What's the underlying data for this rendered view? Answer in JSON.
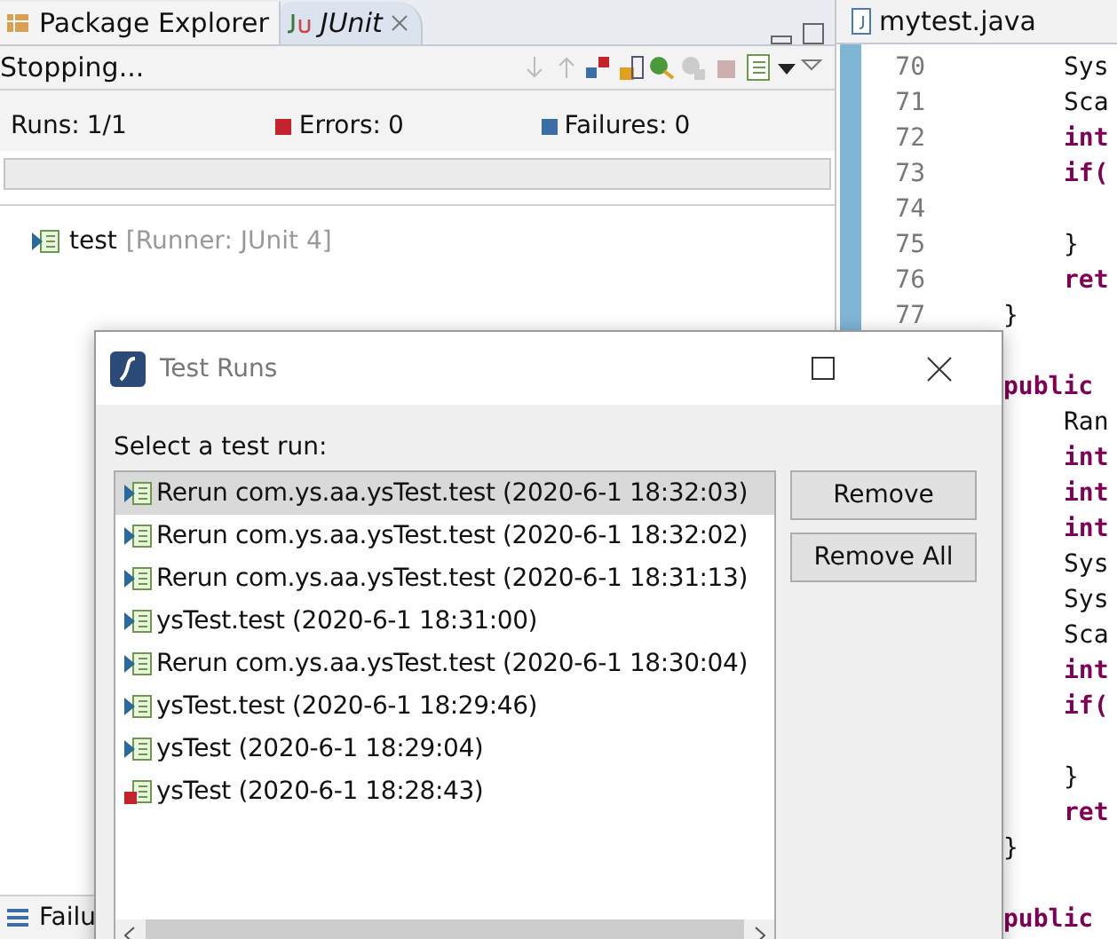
{
  "left_tabs": [
    {
      "label": "Package Explorer",
      "selected": false,
      "closable": false
    },
    {
      "label": "JUnit",
      "selected": true,
      "closable": true
    }
  ],
  "junit": {
    "status": "Stopping...",
    "counters": [
      {
        "kind": "runs",
        "label": "Runs:",
        "value": "1/1"
      },
      {
        "kind": "errors",
        "label": "Errors:",
        "value": "0"
      },
      {
        "kind": "failures",
        "label": "Failures:",
        "value": "0"
      }
    ],
    "progress": {
      "level": 0
    },
    "tree": [
      {
        "name": "test",
        "detail": "[Runner: JUnit 4]"
      }
    ]
  },
  "bottom_tab": {
    "label": "Failu"
  },
  "editor": {
    "tab": "mytest.java",
    "lines": [
      {
        "number": "70",
        "code": "Sys",
        "keyword": false,
        "kind": "inner"
      },
      {
        "number": "71",
        "code": "Sca",
        "keyword": false,
        "kind": "inner"
      },
      {
        "number": "72",
        "code": "int",
        "keyword": true,
        "kind": "inner"
      },
      {
        "number": "73",
        "code": "if(",
        "keyword": true,
        "kind": "inner"
      },
      {
        "number": "74",
        "kind": "inner"
      },
      {
        "number": "75",
        "code": "}",
        "keyword": false,
        "kind": "inner"
      },
      {
        "number": "76",
        "code": "ret",
        "keyword": true,
        "kind": "inner"
      },
      {
        "number": "77",
        "code": "}",
        "keyword": false,
        "kind": "outer"
      },
      {
        "kind": "outer"
      },
      {
        "code": "public",
        "keyword": true,
        "kind": "outer"
      },
      {
        "code": "Ran",
        "keyword": false,
        "kind": "inner"
      },
      {
        "code": "int",
        "keyword": true,
        "kind": "inner"
      },
      {
        "code": "int",
        "keyword": true,
        "kind": "inner"
      },
      {
        "code": "int",
        "keyword": true,
        "kind": "inner"
      },
      {
        "code": "Sys",
        "keyword": false,
        "kind": "inner"
      },
      {
        "code": "Sys",
        "keyword": false,
        "kind": "inner"
      },
      {
        "code": "Sca",
        "keyword": false,
        "kind": "inner"
      },
      {
        "code": "int",
        "keyword": true,
        "kind": "inner"
      },
      {
        "code": "if(",
        "keyword": true,
        "kind": "inner"
      },
      {
        "kind": "inner"
      },
      {
        "code": "}",
        "keyword": false,
        "kind": "inner"
      },
      {
        "code": "ret",
        "keyword": true,
        "kind": "inner"
      },
      {
        "code": "}",
        "keyword": false,
        "kind": "outer"
      },
      {
        "kind": "outer"
      },
      {
        "code": "public",
        "keyword": true,
        "kind": "outer"
      }
    ]
  },
  "dialog": {
    "title": "Test Runs",
    "prompt": "Select a test run:",
    "runs": [
      {
        "label": "Rerun com.ys.aa.ysTest.test (2020-6-1 18:32:03)",
        "kind": "passed",
        "selected": true
      },
      {
        "label": "Rerun com.ys.aa.ysTest.test (2020-6-1 18:32:02)",
        "kind": "passed",
        "selected": false
      },
      {
        "label": "Rerun com.ys.aa.ysTest.test (2020-6-1 18:31:13)",
        "kind": "passed",
        "selected": false
      },
      {
        "label": "ysTest.test (2020-6-1 18:31:00)",
        "kind": "passed",
        "selected": false
      },
      {
        "label": "Rerun com.ys.aa.ysTest.test (2020-6-1 18:30:04)",
        "kind": "passed",
        "selected": false
      },
      {
        "label": "ysTest.test (2020-6-1 18:29:46)",
        "kind": "passed",
        "selected": false
      },
      {
        "label": "ysTest (2020-6-1 18:29:04)",
        "kind": "passed",
        "selected": false
      },
      {
        "label": "ysTest (2020-6-1 18:28:43)",
        "kind": "error",
        "selected": false
      }
    ],
    "buttons": [
      "Remove",
      "Remove All"
    ]
  }
}
